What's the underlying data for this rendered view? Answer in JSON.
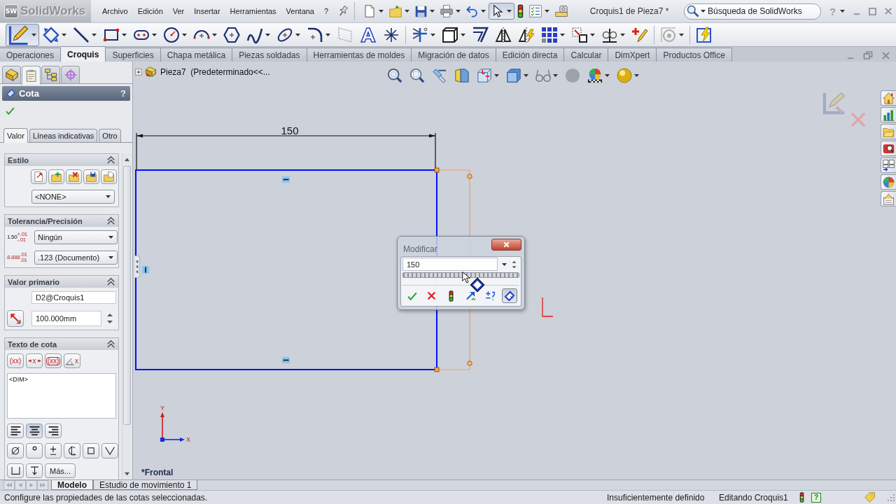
{
  "title_bar": {
    "logo_mark": "SW",
    "logo": "SolidWorks",
    "menu": [
      "Archivo",
      "Edición",
      "Ver",
      "Insertar",
      "Herramientas",
      "Ventana",
      "?"
    ],
    "select_pressed": true,
    "document_title": "Croquis1 de Pieza7 *",
    "search": {
      "placeholder": "Búsqueda de SolidWorks"
    },
    "help": "?"
  },
  "command_manager": {
    "sketch_pressed": true
  },
  "tabs": [
    {
      "label": "Operaciones",
      "selected": false
    },
    {
      "label": "Croquis",
      "selected": true
    },
    {
      "label": "Superficies",
      "selected": false
    },
    {
      "label": "Chapa metálica",
      "selected": false
    },
    {
      "label": "Piezas soldadas",
      "selected": false
    },
    {
      "label": "Herramientas de moldes",
      "selected": false
    },
    {
      "label": "Migración de datos",
      "selected": false
    },
    {
      "label": "Edición directa",
      "selected": false
    },
    {
      "label": "Calcular",
      "selected": false
    },
    {
      "label": "DimXpert",
      "selected": false
    },
    {
      "label": "Productos Office",
      "selected": false
    }
  ],
  "property_manager": {
    "view_tabs": [
      {
        "selected": false
      },
      {
        "selected": true
      },
      {
        "selected": false
      },
      {
        "selected": false
      }
    ],
    "title": "Cota",
    "help": "?",
    "tabs": [
      {
        "label": "Valor",
        "selected": true
      },
      {
        "label": "Líneas indicativas",
        "selected": false
      },
      {
        "label": "Otro",
        "selected": false
      }
    ],
    "groups": [
      {
        "kind": "style",
        "title": "Estilo",
        "expanded": true,
        "style": "<NONE>"
      },
      {
        "kind": "tolerance",
        "title": "Tolerancia/Precisión",
        "expanded": true,
        "tolerance_sample": {
          "value": "1.50",
          "upper": "+.01",
          "lower": "-.01"
        },
        "tolerance": "Ningún",
        "precision_sample": {
          "value": "8.888",
          "upper": ".01",
          "lower": ".01"
        },
        "precision": ".123 (Documento)"
      },
      {
        "kind": "primary",
        "title": "Valor primario",
        "expanded": true,
        "name": "D2@Croquis1",
        "value": "100.000mm"
      },
      {
        "kind": "text",
        "title": "Texto de cota",
        "expanded": true,
        "insert_buttons": [
          {
            "kind": "parentheses",
            "text": "(xx)"
          },
          {
            "kind": "center",
            "text": "x"
          },
          {
            "kind": "inspection",
            "text": "(xx)"
          },
          {
            "kind": "offset",
            "text": "x"
          }
        ],
        "text": "<DIM>",
        "alignment": [
          {
            "selected": false
          },
          {
            "selected": true
          },
          {
            "selected": false
          }
        ],
        "more": "Más..."
      }
    ]
  },
  "graphics": {
    "tree_item": "Pieza7  (Predeterminado<<...",
    "dimension": "150",
    "origin": {
      "x": "X",
      "y": "Y"
    },
    "modify_dialog": {
      "title": "Modificar",
      "value": "150",
      "mark_pressed": true
    },
    "view_label": "*Frontal"
  },
  "bottom_tabs": [
    {
      "label": "Modelo",
      "selected": true
    },
    {
      "label": "Estudio de movimiento 1",
      "selected": false
    }
  ],
  "status_bar": {
    "message": "Configure las propiedades de las cotas seleccionadas.",
    "definition": "Insuficientemente definido",
    "editing": "Editando Croquis1",
    "help": "?"
  }
}
